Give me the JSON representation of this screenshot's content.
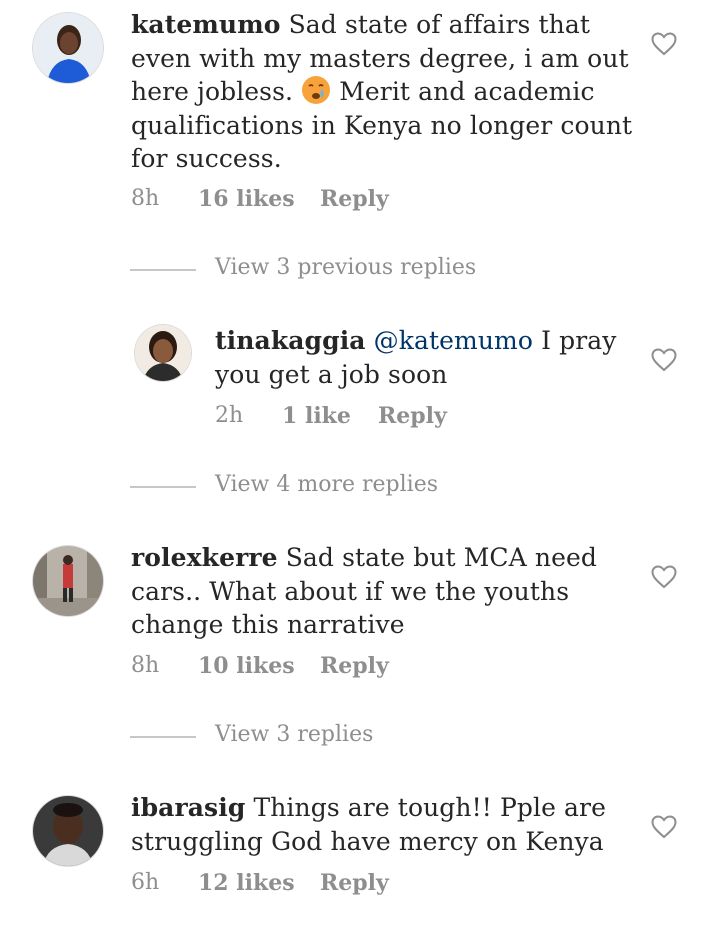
{
  "comments": [
    {
      "username": "katemumo",
      "text_before_emoji": "Sad state of affairs that even with my masters degree, i am out here jobless.",
      "emoji": "crying-face",
      "text_after_emoji": "Merit and academic qualifications in Kenya no longer count for success.",
      "time": "8h",
      "likes": "16 likes",
      "reply": "Reply"
    },
    {
      "username": "rolexkerre",
      "text": "Sad state but MCA  need cars.. What about if we the youths change this narrative",
      "time": "8h",
      "likes": "10 likes",
      "reply": "Reply"
    },
    {
      "username": "ibarasig",
      "text": "Things are tough!! Pple are struggling  God have mercy on Kenya",
      "time": "6h",
      "likes": "12 likes",
      "reply": "Reply"
    }
  ],
  "reply": {
    "username": "tinakaggia",
    "mention": "@katemumo",
    "text": "I pray you get a job soon",
    "time": "2h",
    "likes": "1 like",
    "reply": "Reply"
  },
  "view_replies": {
    "previous": "View 3 previous replies",
    "more": "View 4 more replies",
    "three": "View 3 replies"
  },
  "colors": {
    "text": "#262626",
    "meta": "#8e8e8e",
    "mention": "#003569",
    "divider": "#c7c7c7"
  },
  "icons": {
    "like": "heart-outline-icon"
  }
}
